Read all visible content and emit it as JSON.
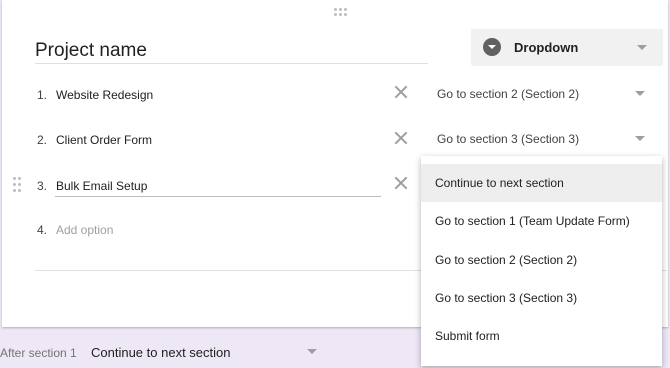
{
  "question": {
    "title": "Project name",
    "type": "Dropdown"
  },
  "options": [
    {
      "num": "1.",
      "text": "Website Redesign",
      "goto": "Go to section 2 (Section 2)"
    },
    {
      "num": "2.",
      "text": "Client Order Form",
      "goto": "Go to section 3 (Section 3)"
    },
    {
      "num": "3.",
      "text": "Bulk Email Setup"
    },
    {
      "num": "4.",
      "text": "Add option"
    }
  ],
  "menu": {
    "items": [
      "Continue to next section",
      "Go to section 1 (Team Update Form)",
      "Go to section 2 (Section 2)",
      "Go to section 3 (Section 3)",
      "Submit form"
    ],
    "highlighted_index": 0
  },
  "after_section": {
    "label": "After section 1",
    "value": "Continue to next section"
  },
  "colors": {
    "page_background": "#ede7f6",
    "card": "#ffffff",
    "highlight": "#eeeeee"
  }
}
